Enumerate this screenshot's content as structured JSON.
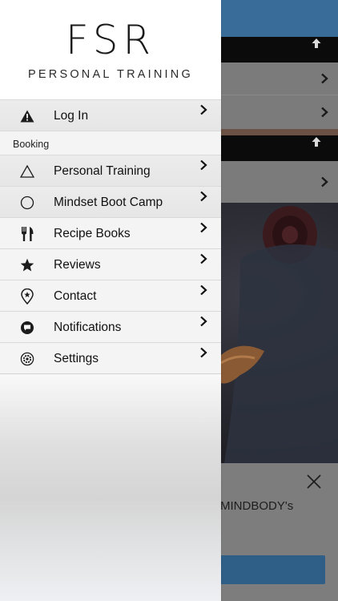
{
  "app": {
    "logo_mark": "FSR",
    "logo_subtitle": "PERSONAL TRAINING"
  },
  "menu": {
    "items_top": [
      {
        "label": "Log In",
        "icon": "warning-icon"
      }
    ],
    "section_label": "Booking",
    "items": [
      {
        "label": "Personal Training",
        "icon": "triangle-outline-icon"
      },
      {
        "label": "Mindset Boot Camp",
        "icon": "circle-outline-icon"
      },
      {
        "label": "Recipe Books",
        "icon": "cutlery-icon"
      },
      {
        "label": "Reviews",
        "icon": "star-icon"
      },
      {
        "label": "Contact",
        "icon": "map-pin-icon"
      },
      {
        "label": "Notifications",
        "icon": "speech-bubble-icon"
      },
      {
        "label": "Settings",
        "icon": "gear-icon"
      }
    ]
  },
  "background": {
    "panel_text": "MINDBODY's"
  },
  "colors": {
    "topbar_blue": "#3a6c9a",
    "button_blue": "#2f5e86",
    "drawer_bg": "#f4f4f4"
  }
}
